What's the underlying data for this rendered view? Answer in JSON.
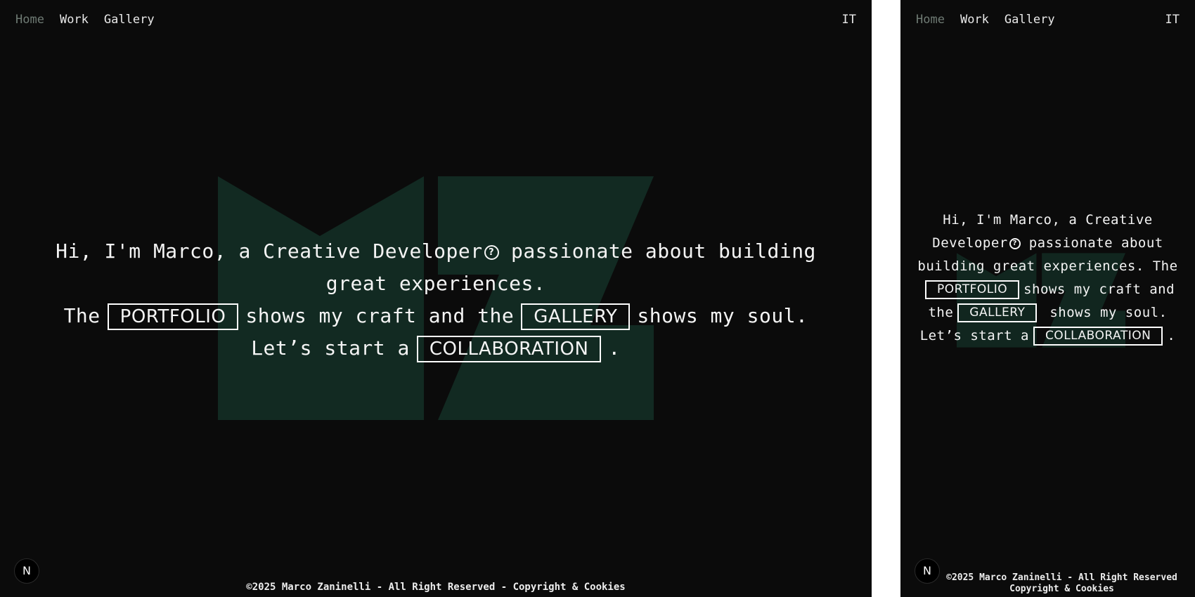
{
  "nav": {
    "items": [
      {
        "label": "Home",
        "active": true
      },
      {
        "label": "Work",
        "active": false
      },
      {
        "label": "Gallery",
        "active": false
      }
    ],
    "lang": "IT"
  },
  "hero": {
    "line1": "Hi, I'm Marco, a Creative Developer",
    "line1b": "passionate about building great experiences.",
    "the": "The",
    "portfolio": "PORTFOLIO",
    "shows_craft": "shows my craft and the",
    "gallery": "GALLERY",
    "shows_soul": "shows my soul.",
    "lets_start": "Let’s start a",
    "collaboration": "COLLABORATION",
    "period": "."
  },
  "icons": {
    "help": "question-circle-icon",
    "badge": "N"
  },
  "footer": {
    "text": "©2025 Marco Zaninelli - All Right Reserved - Copyright & Cookies",
    "mobile_line1": "©2025 Marco Zaninelli - All Right Reserved",
    "mobile_line2": "Copyright & Cookies"
  },
  "colors": {
    "background": "#0b0b0b",
    "logo": "#122a22",
    "inactive_nav": "#6f7b74",
    "text": "#f4f4f4"
  }
}
